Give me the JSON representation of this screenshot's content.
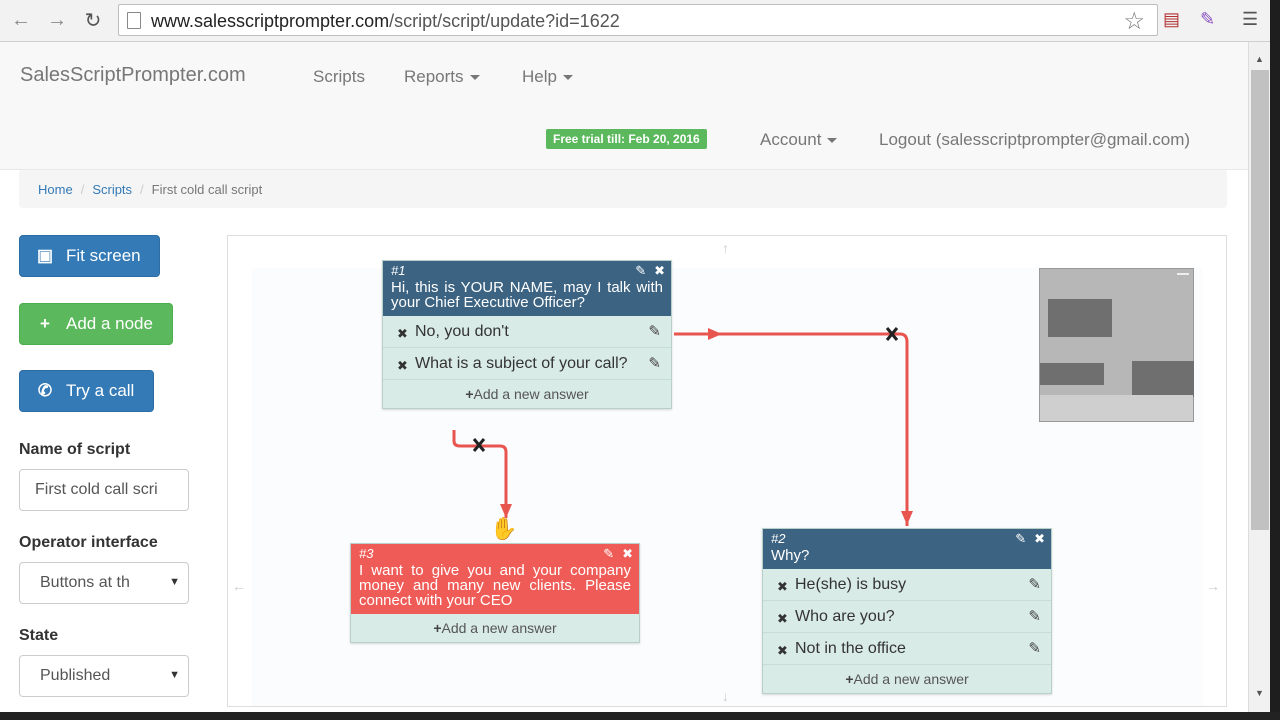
{
  "browser": {
    "back_icon": "arrow-left-icon",
    "forward_icon": "arrow-right-icon",
    "reload_icon": "reload-icon",
    "url_host": "www.salesscriptprompter.com",
    "url_path": "/script/script/update?id=1622"
  },
  "navbar": {
    "brand": "SalesScriptPrompter.com",
    "scripts": "Scripts",
    "reports": "Reports",
    "help": "Help",
    "trial_badge": "Free trial till: Feb 20, 2016",
    "account": "Account",
    "logout": "Logout (salesscriptprompter@gmail.com)"
  },
  "breadcrumb": {
    "home": "Home",
    "scripts": "Scripts",
    "current": "First cold call script"
  },
  "sidebar": {
    "fit_screen": "Fit screen",
    "add_node": "Add a node",
    "try_call": "Try a call",
    "name_label": "Name of script",
    "name_value": "First cold call scri",
    "operator_label": "Operator interface",
    "operator_value": "Buttons at th",
    "state_label": "State",
    "state_value": "Published"
  },
  "colors": {
    "primary": "#337ab7",
    "success": "#5cb85c",
    "node_dark": "#3c6382",
    "node_red": "#ef5c57",
    "edge": "#e8554f"
  },
  "canvas": {
    "add_answer": "Add a new answer",
    "node1": {
      "num": "#1",
      "title": "Hi, this is YOUR NAME, may I talk with your Chief Executive Officer?",
      "answers": [
        "No, you don't",
        "What is a subject of your call?"
      ]
    },
    "node2": {
      "num": "#2",
      "title": "Why?",
      "answers": [
        "He(she) is busy",
        "Who are you?",
        "Not in the office"
      ]
    },
    "node3": {
      "num": "#3",
      "title": "I want to give you and your company money and many new clients. Please connect with your CEO"
    }
  }
}
